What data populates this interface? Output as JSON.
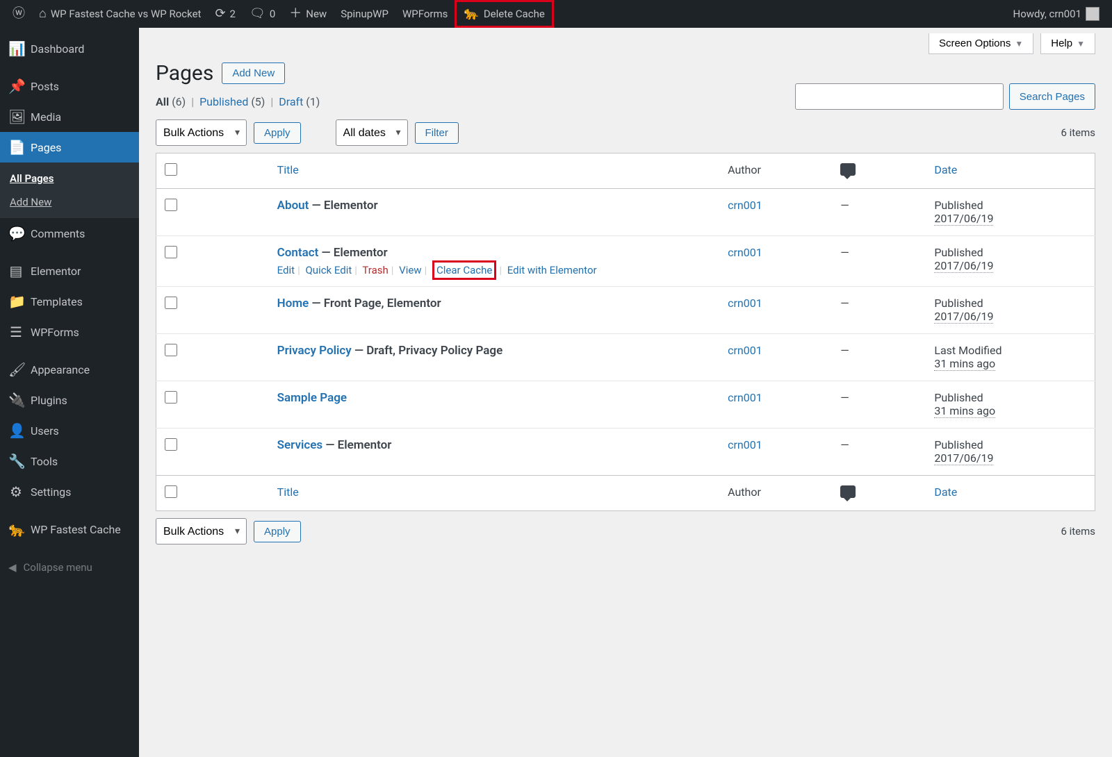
{
  "adminbar": {
    "site_title": "WP Fastest Cache vs WP Rocket",
    "updates_count": "2",
    "comments_count": "0",
    "new_label": "New",
    "items": [
      "SpinupWP",
      "WPForms"
    ],
    "delete_cache": "Delete Cache",
    "howdy": "Howdy, crn001"
  },
  "sidebar": {
    "items": [
      {
        "icon": "📊",
        "label": "Dashboard"
      },
      {
        "icon": "📌",
        "label": "Posts"
      },
      {
        "icon": "🖼",
        "label": "Media"
      },
      {
        "icon": "📄",
        "label": "Pages",
        "current": true
      },
      {
        "icon": "💬",
        "label": "Comments"
      },
      {
        "icon": "▤",
        "label": "Elementor"
      },
      {
        "icon": "📁",
        "label": "Templates"
      },
      {
        "icon": "☰",
        "label": "WPForms"
      },
      {
        "icon": "🖌",
        "label": "Appearance"
      },
      {
        "icon": "🔌",
        "label": "Plugins"
      },
      {
        "icon": "👤",
        "label": "Users"
      },
      {
        "icon": "🔧",
        "label": "Tools"
      },
      {
        "icon": "⚙",
        "label": "Settings"
      },
      {
        "icon": "🐆",
        "label": "WP Fastest Cache"
      }
    ],
    "submenu": {
      "all_pages": "All Pages",
      "add_new": "Add New"
    },
    "collapse": "Collapse menu"
  },
  "screen": {
    "options": "Screen Options",
    "help": "Help"
  },
  "heading": {
    "title": "Pages",
    "add_new": "Add New"
  },
  "filters": {
    "all_label": "All",
    "all_count": "(6)",
    "published_label": "Published",
    "published_count": "(5)",
    "draft_label": "Draft",
    "draft_count": "(1)"
  },
  "search": {
    "button": "Search Pages"
  },
  "bulk": {
    "actions": "Bulk Actions",
    "apply": "Apply",
    "dates": "All dates",
    "filter": "Filter"
  },
  "count_label": "6 items",
  "columns": {
    "title": "Title",
    "author": "Author",
    "date": "Date"
  },
  "row_actions": {
    "edit": "Edit",
    "quick_edit": "Quick Edit",
    "trash": "Trash",
    "view": "View",
    "clear_cache": "Clear Cache",
    "edit_elementor": "Edit with Elementor"
  },
  "rows": [
    {
      "title": "About",
      "state": " — Elementor",
      "author": "crn001",
      "comments": "—",
      "date_status": "Published",
      "date_ts": "2017/06/19"
    },
    {
      "title": "Contact",
      "state": " — Elementor",
      "author": "crn001",
      "comments": "—",
      "date_status": "Published",
      "date_ts": "2017/06/19",
      "show_actions": true
    },
    {
      "title": "Home",
      "state": " — Front Page, Elementor",
      "author": "crn001",
      "comments": "—",
      "date_status": "Published",
      "date_ts": "2017/06/19"
    },
    {
      "title": "Privacy Policy",
      "state": " — Draft, Privacy Policy Page",
      "author": "crn001",
      "comments": "—",
      "date_status": "Last Modified",
      "date_ts": "31 mins ago"
    },
    {
      "title": "Sample Page",
      "state": "",
      "author": "crn001",
      "comments": "—",
      "date_status": "Published",
      "date_ts": "31 mins ago"
    },
    {
      "title": "Services",
      "state": " — Elementor",
      "author": "crn001",
      "comments": "—",
      "date_status": "Published",
      "date_ts": "2017/06/19"
    }
  ]
}
